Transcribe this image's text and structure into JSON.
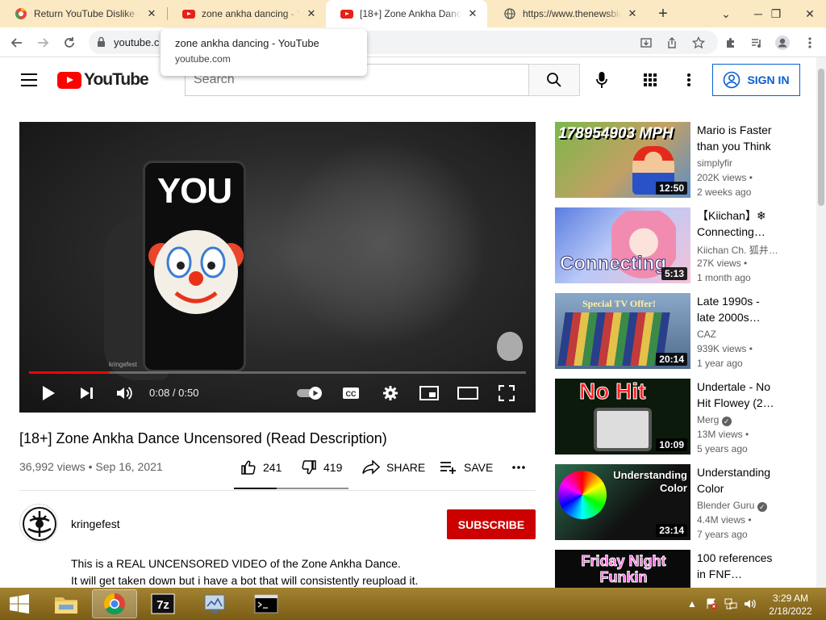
{
  "browser": {
    "tabs": [
      {
        "title": "Return YouTube Dislike -",
        "favicon": "extension-favicon-icon"
      },
      {
        "title": "zone ankha dancing - You",
        "favicon": "youtube-favicon-icon"
      },
      {
        "title": "[18+] Zone Ankha Dance",
        "favicon": "youtube-favicon-icon"
      },
      {
        "title": "https://www.thenewsbig",
        "favicon": "globe-icon"
      }
    ],
    "address": "youtube.c",
    "hover_card": {
      "title": "zone ankha dancing - YouTube",
      "domain": "youtube.com"
    }
  },
  "yt": {
    "logo_text": "YouTube",
    "search_placeholder": "Search",
    "sign_in": "SIGN IN"
  },
  "player": {
    "overlay_text": "YOU",
    "watermark": "kringefest",
    "time": "0:08 / 0:50",
    "progress_fraction": 0.16,
    "progress_color": "#ff0000"
  },
  "video": {
    "title": "[18+] Zone Ankha Dance Uncensored (Read Description)",
    "meta": "36,992 views • Sep 16, 2021",
    "likes": "241",
    "dislikes": "419",
    "share": "SHARE",
    "save": "SAVE",
    "like_ratio": 0.37,
    "channel": "kringefest",
    "subscribe": "SUBSCRIBE",
    "desc_line1": "This is a REAL UNCENSORED VIDEO of the Zone Ankha Dance.",
    "desc_line2": "It will get taken down but i have a bot that will consistently reupload it."
  },
  "recommendations": [
    {
      "title": "Mario is Faster than you Think",
      "channel": "simplyfir",
      "views": "202K views •",
      "age": "2 weeks ago",
      "duration": "12:50",
      "thumb_text": "178954903 MPH"
    },
    {
      "title": "【Kiichan】❄ Connecting…",
      "channel": "Kiichan Ch. 狐井…",
      "views": "27K views •",
      "age": "1 month ago",
      "duration": "5:13",
      "thumb_text": "Connecting"
    },
    {
      "title": "Late 1990s - late 2000s…",
      "channel": "CAZ",
      "views": "939K views •",
      "age": "1 year ago",
      "duration": "20:14",
      "thumb_text": "Special TV Offer!"
    },
    {
      "title": "Undertale - No Hit Flowey (2…",
      "channel": "Merg",
      "views": "13M views •",
      "age": "5 years ago",
      "duration": "10:09",
      "thumb_text": "No Hit"
    },
    {
      "title": "Understanding Color",
      "channel": "Blender Guru",
      "views": "4.4M views •",
      "age": "7 years ago",
      "duration": "23:14",
      "thumb_text": "Understanding Color"
    },
    {
      "title": "100 references in FNF…",
      "channel": "",
      "views": "",
      "age": "",
      "duration": "",
      "thumb_text": "Friday Night Funkin"
    }
  ],
  "taskbar": {
    "clock_time": "3:29 AM",
    "clock_date": "2/18/2022"
  },
  "colors": {
    "accent_red": "#cc0000",
    "link_blue": "#065fd4",
    "taskbar": "#8b6c1e",
    "tabstrip": "#fbe9c3"
  }
}
